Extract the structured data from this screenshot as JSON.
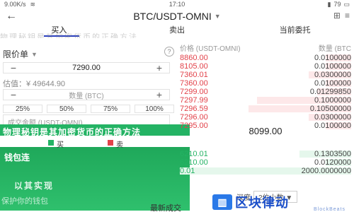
{
  "status": {
    "speed": "9.00K/s",
    "time": "17:10",
    "battery": "79"
  },
  "header": {
    "title": "BTC/USDT-OMNI"
  },
  "tabs": [
    {
      "label": "买入",
      "active": true
    },
    {
      "label": "卖出",
      "active": false
    },
    {
      "label": "当前委托",
      "active": false
    }
  ],
  "order": {
    "type_label": "限价单",
    "price_value": "7290.00",
    "estimate_label": "估值：¥ 49644.90",
    "amount_placeholder": "数量 (BTC)",
    "percent_options": [
      "25%",
      "50%",
      "75%",
      "100%"
    ],
    "total_placeholder": "成交金额 (USDT-OMNI)"
  },
  "book": {
    "price_header": "价格 (USDT-OMNI)",
    "qty_header": "数量 (BTC",
    "asks": [
      {
        "price": "8860.00",
        "qty": "0.0100000",
        "depth": 0.15
      },
      {
        "price": "8105.00",
        "qty": "0.0100000",
        "depth": 0.15
      },
      {
        "price": "7360.01",
        "qty": "0.0300000",
        "depth": 0.25
      },
      {
        "price": "7360.00",
        "qty": "0.0100000",
        "depth": 0.15
      },
      {
        "price": "7299.00",
        "qty": "0.01299850",
        "depth": 0.2
      },
      {
        "price": "7297.99",
        "qty": "0.1000000",
        "depth": 0.55
      },
      {
        "price": "7296.59",
        "qty": "0.10500000",
        "depth": 0.6
      },
      {
        "price": "7296.00",
        "qty": "0.0300000",
        "depth": 0.25
      },
      {
        "price": "7295.00",
        "qty": "0.0100000",
        "depth": 0.15
      }
    ],
    "last_price": "8099.00",
    "bids": [
      {
        "price": "6210.01",
        "qty": "0.1303500",
        "depth": 0.3
      },
      {
        "price": "6210.00",
        "qty": "0.0120000",
        "depth": 0.15
      },
      {
        "price": "0.01",
        "qty": "2000.0000000",
        "depth": 1.0
      }
    ],
    "depth_label": "深度",
    "depth_value": "2位小数",
    "latest_deal_label": "最新成交"
  },
  "overlay": {
    "line1": "物理秘钥是其加密货币的正确方法",
    "line2": "钱包连",
    "line3": "以其实现",
    "line4": "保护你的钱包",
    "buy_label": "买",
    "sell_label": "卖"
  },
  "logo": {
    "text": "区块律动",
    "sub": "BlockBeats"
  },
  "colors": {
    "buy": "#24b364",
    "sell": "#e2424a",
    "accent": "#2a3fbf"
  }
}
